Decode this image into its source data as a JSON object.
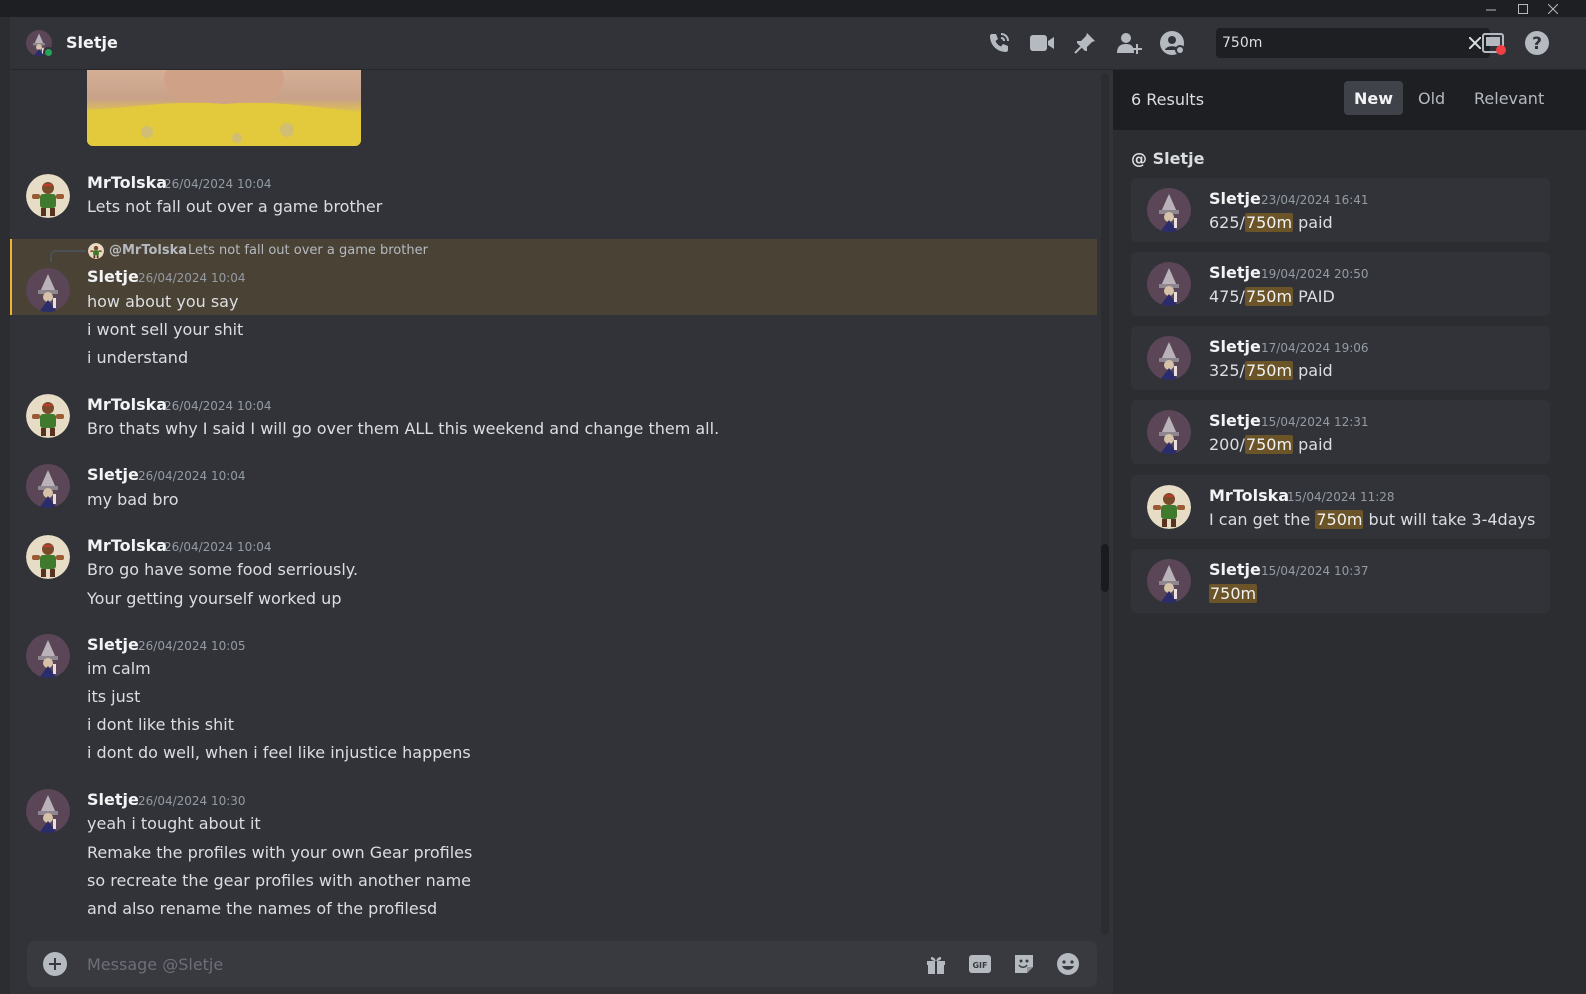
{
  "window": {
    "controls": [
      "minimize-icon",
      "maximize-icon",
      "close-icon"
    ]
  },
  "header": {
    "title": "Sletje",
    "search": {
      "value": "750m",
      "placeholder": "Search"
    },
    "icons": [
      "phone-call-icon",
      "video-call-icon",
      "pin-icon",
      "add-friend-icon",
      "profile-icon",
      "inbox-icon",
      "help-icon"
    ]
  },
  "chat": {
    "messages": [
      {
        "author": "MrTolska",
        "time": "26/04/2024 10:04",
        "lines": [
          "Lets not fall out over a game brother"
        ]
      },
      {
        "reply_author": "@MrTolska",
        "reply_text": "Lets not fall out over a game brother",
        "author": "Sletje",
        "time": "26/04/2024 10:04",
        "lines": [
          "how about you say",
          "i wont sell your shit",
          "i understand"
        ]
      },
      {
        "author": "MrTolska",
        "time": "26/04/2024 10:04",
        "lines": [
          "Bro thats why I said I will go over them ALL this weekend and change them all."
        ]
      },
      {
        "author": "Sletje",
        "time": "26/04/2024 10:04",
        "lines": [
          "my bad bro"
        ]
      },
      {
        "author": "MrTolska",
        "time": "26/04/2024 10:04",
        "lines": [
          "Bro go have some food serriously.",
          "Your getting yourself worked up"
        ]
      },
      {
        "author": "Sletje",
        "time": "26/04/2024 10:05",
        "lines": [
          "im calm",
          "its just",
          "i dont like this shit",
          "i dont do well, when i feel like injustice happens"
        ]
      },
      {
        "author": "Sletje",
        "time": "26/04/2024 10:30",
        "lines": [
          "yeah i tought about it",
          "Remake the profiles with your own Gear profiles",
          "so recreate the gear profiles with another name",
          "and also rename the names of the profilesd"
        ]
      }
    ]
  },
  "composer": {
    "placeholder": "Message @Sletje",
    "gif_label": "GIF"
  },
  "results": {
    "count_label": "6 Results",
    "tabs": [
      "New",
      "Old",
      "Relevant"
    ],
    "active_tab": "New",
    "channel": "@ Sletje",
    "items": [
      {
        "author": "Sletje",
        "time": "23/04/2024 16:41",
        "pre": "625/",
        "match": "750m",
        "post": " paid"
      },
      {
        "author": "Sletje",
        "time": "19/04/2024 20:50",
        "pre": "475/",
        "match": "750m",
        "post": " PAID"
      },
      {
        "author": "Sletje",
        "time": "17/04/2024 19:06",
        "pre": "325/",
        "match": "750m",
        "post": " paid"
      },
      {
        "author": "Sletje",
        "time": "15/04/2024 12:31",
        "pre": "200/",
        "match": "750m",
        "post": " paid"
      },
      {
        "author": "MrTolska",
        "time": "15/04/2024 11:28",
        "pre": "I can get the ",
        "match": "750m",
        "post": " but will take 3-4days"
      },
      {
        "author": "Sletje",
        "time": "15/04/2024 10:37",
        "pre": "",
        "match": "750m",
        "post": ""
      }
    ]
  },
  "colors": {
    "accent_highlight": "#f0b232",
    "match_bg": "#6a5428",
    "online": "#23a55a"
  }
}
